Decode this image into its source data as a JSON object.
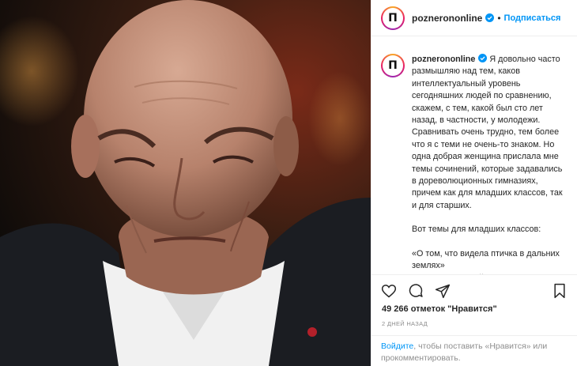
{
  "post": {
    "username": "poznerononline",
    "follow_label": "Подписаться",
    "avatar_letter": "П",
    "caption_lines": [
      "Я довольно часто размышляю над тем, каков интеллектуальный уровень сегодняшних людей по сравнению, скажем, с тем, какой был сто лет назад, в частности, у молодежи. Сравнивать очень трудно, тем более что я с теми не очень-то знаком. Но одна добрая женщина прислала мне темы сочинений, которые задавались в дореволюционных гимназиях, причем как для младших классов, так и для старших.",
      "Вот темы для младших классов:",
      "«О том, что видела птичка в дальних землях»\n«История постройки дома и разведение при нем сада»"
    ],
    "likes_text": "49 266 отметок \"Нравится\"",
    "date_text": "2 ДНЕЙ НАЗАД",
    "footer": {
      "login_link": "Войдите",
      "login_rest": ", чтобы поставить «Нравится» или прокомментировать."
    }
  },
  "icons": [
    "heart-icon",
    "comment-icon",
    "share-icon",
    "bookmark-icon",
    "verified-badge-icon"
  ],
  "colors": {
    "accent": "#0095f6",
    "text": "#262626",
    "muted": "#8e8e8e"
  }
}
